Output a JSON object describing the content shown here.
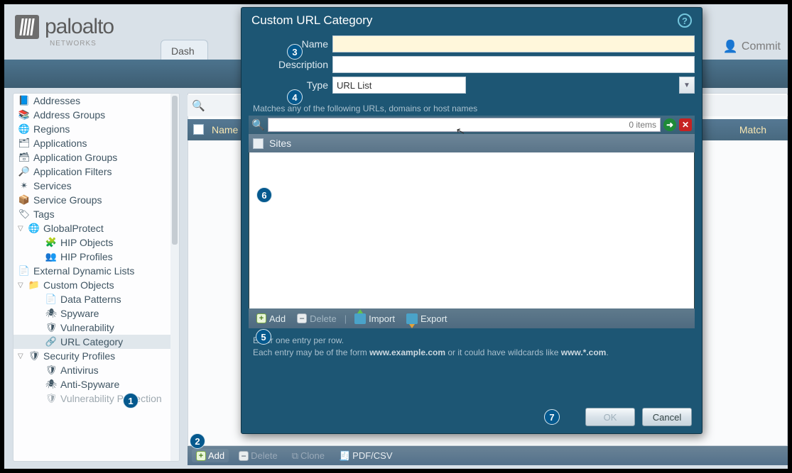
{
  "brand": {
    "name": "paloalto",
    "sub": "NETWORKS"
  },
  "header": {
    "tab_dashboard": "Dash",
    "commit": "Commit"
  },
  "sidebar": {
    "items": [
      {
        "icon": "📘",
        "label": "Addresses"
      },
      {
        "icon": "📚",
        "label": "Address Groups"
      },
      {
        "icon": "🌐",
        "label": "Regions"
      },
      {
        "icon": "🗂",
        "label": "Applications"
      },
      {
        "icon": "🗃",
        "label": "Application Groups"
      },
      {
        "icon": "🔎",
        "label": "Application Filters"
      },
      {
        "icon": "✴",
        "label": "Services"
      },
      {
        "icon": "📦",
        "label": "Service Groups"
      },
      {
        "icon": "🏷",
        "label": "Tags"
      }
    ],
    "gp": {
      "label": "GlobalProtect",
      "children": [
        {
          "icon": "🧩",
          "label": "HIP Objects"
        },
        {
          "icon": "👥",
          "label": "HIP Profiles"
        }
      ]
    },
    "edl": {
      "icon": "📄",
      "label": "External Dynamic Lists"
    },
    "custom": {
      "label": "Custom Objects",
      "children": [
        {
          "icon": "📄",
          "label": "Data Patterns"
        },
        {
          "icon": "🕷",
          "label": "Spyware"
        },
        {
          "icon": "🛡",
          "label": "Vulnerability"
        },
        {
          "icon": "🔗",
          "label": "URL Category"
        }
      ]
    },
    "sec": {
      "label": "Security Profiles",
      "children": [
        {
          "icon": "🛡",
          "label": "Antivirus"
        },
        {
          "icon": "🕷",
          "label": "Anti-Spyware"
        },
        {
          "icon": "🛡",
          "label": "Vulnerability Protection"
        }
      ]
    }
  },
  "main": {
    "col_name": "Name",
    "col_match": "Match"
  },
  "footer": {
    "add": "Add",
    "delete": "Delete",
    "clone": "Clone",
    "pdf": "PDF/CSV"
  },
  "dialog": {
    "title": "Custom URL Category",
    "labels": {
      "name": "Name",
      "description": "Description",
      "type": "Type"
    },
    "type_value": "URL List",
    "match_hint": "Matches any of the following URLs, domains or host names",
    "items_count": "0 items",
    "sites_header": "Sites",
    "toolbar": {
      "add": "Add",
      "delete": "Delete",
      "import": "Import",
      "export": "Export"
    },
    "hint1": "Enter one entry per row.",
    "hint2a": "Each entry may be of the form ",
    "hint2b": "www.example.com",
    "hint2c": " or it could have wildcards like ",
    "hint2d": "www.*.com",
    "hint2e": ".",
    "ok": "OK",
    "cancel": "Cancel"
  },
  "callouts": {
    "1": "1",
    "2": "2",
    "3": "3",
    "4": "4",
    "5": "5",
    "6": "6",
    "7": "7"
  }
}
